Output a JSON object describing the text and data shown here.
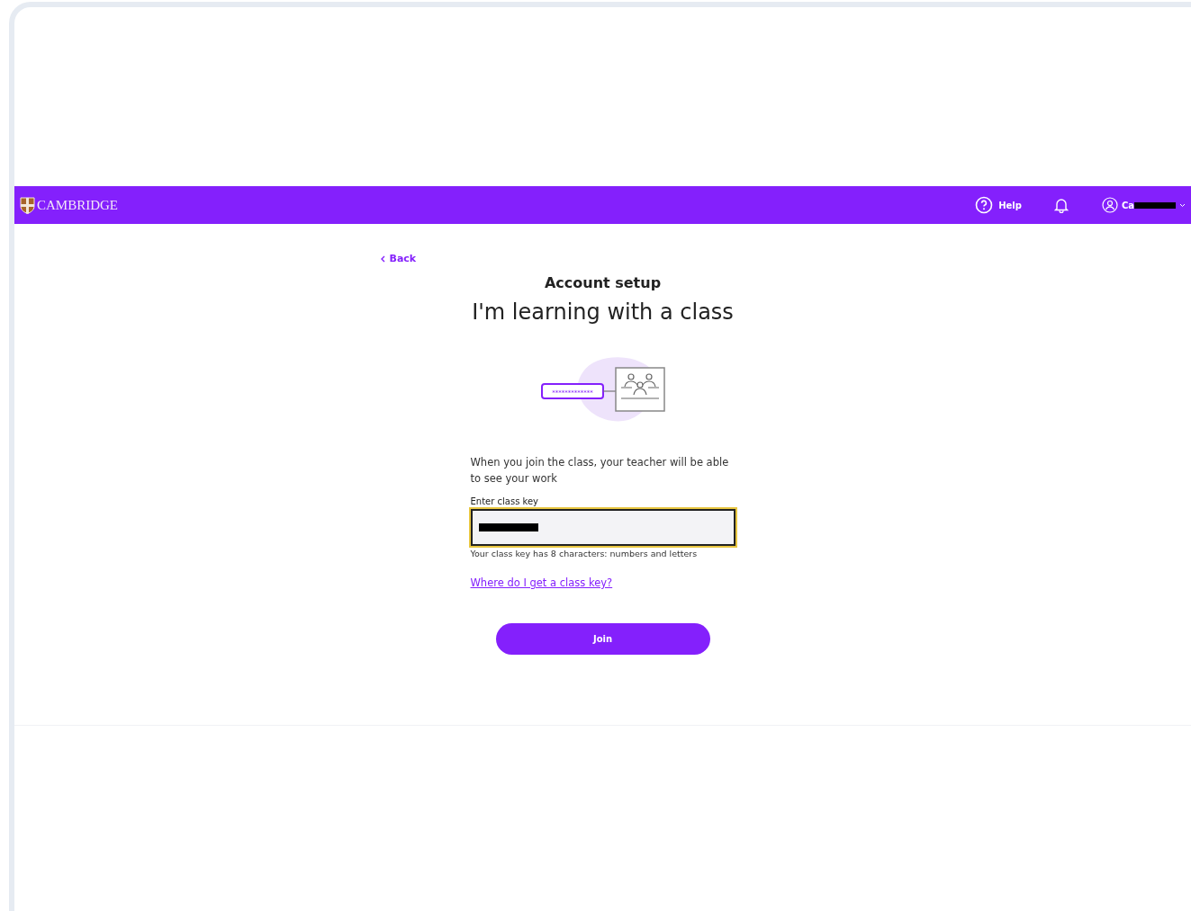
{
  "header": {
    "brand": "CAMBRIDGE",
    "help": "Help",
    "user": "Ca"
  },
  "back": "Back",
  "subtitle": "Account setup",
  "title": "I'm learning with a class",
  "illustration": {
    "key_text": "*************"
  },
  "description": "When you join the class, your teacher will be able to see your work",
  "field": {
    "label": "Enter class key",
    "hint": "Your class key has 8 characters: numbers and letters",
    "focused": true
  },
  "link": "Where do I get a class key?",
  "button": "Join"
}
